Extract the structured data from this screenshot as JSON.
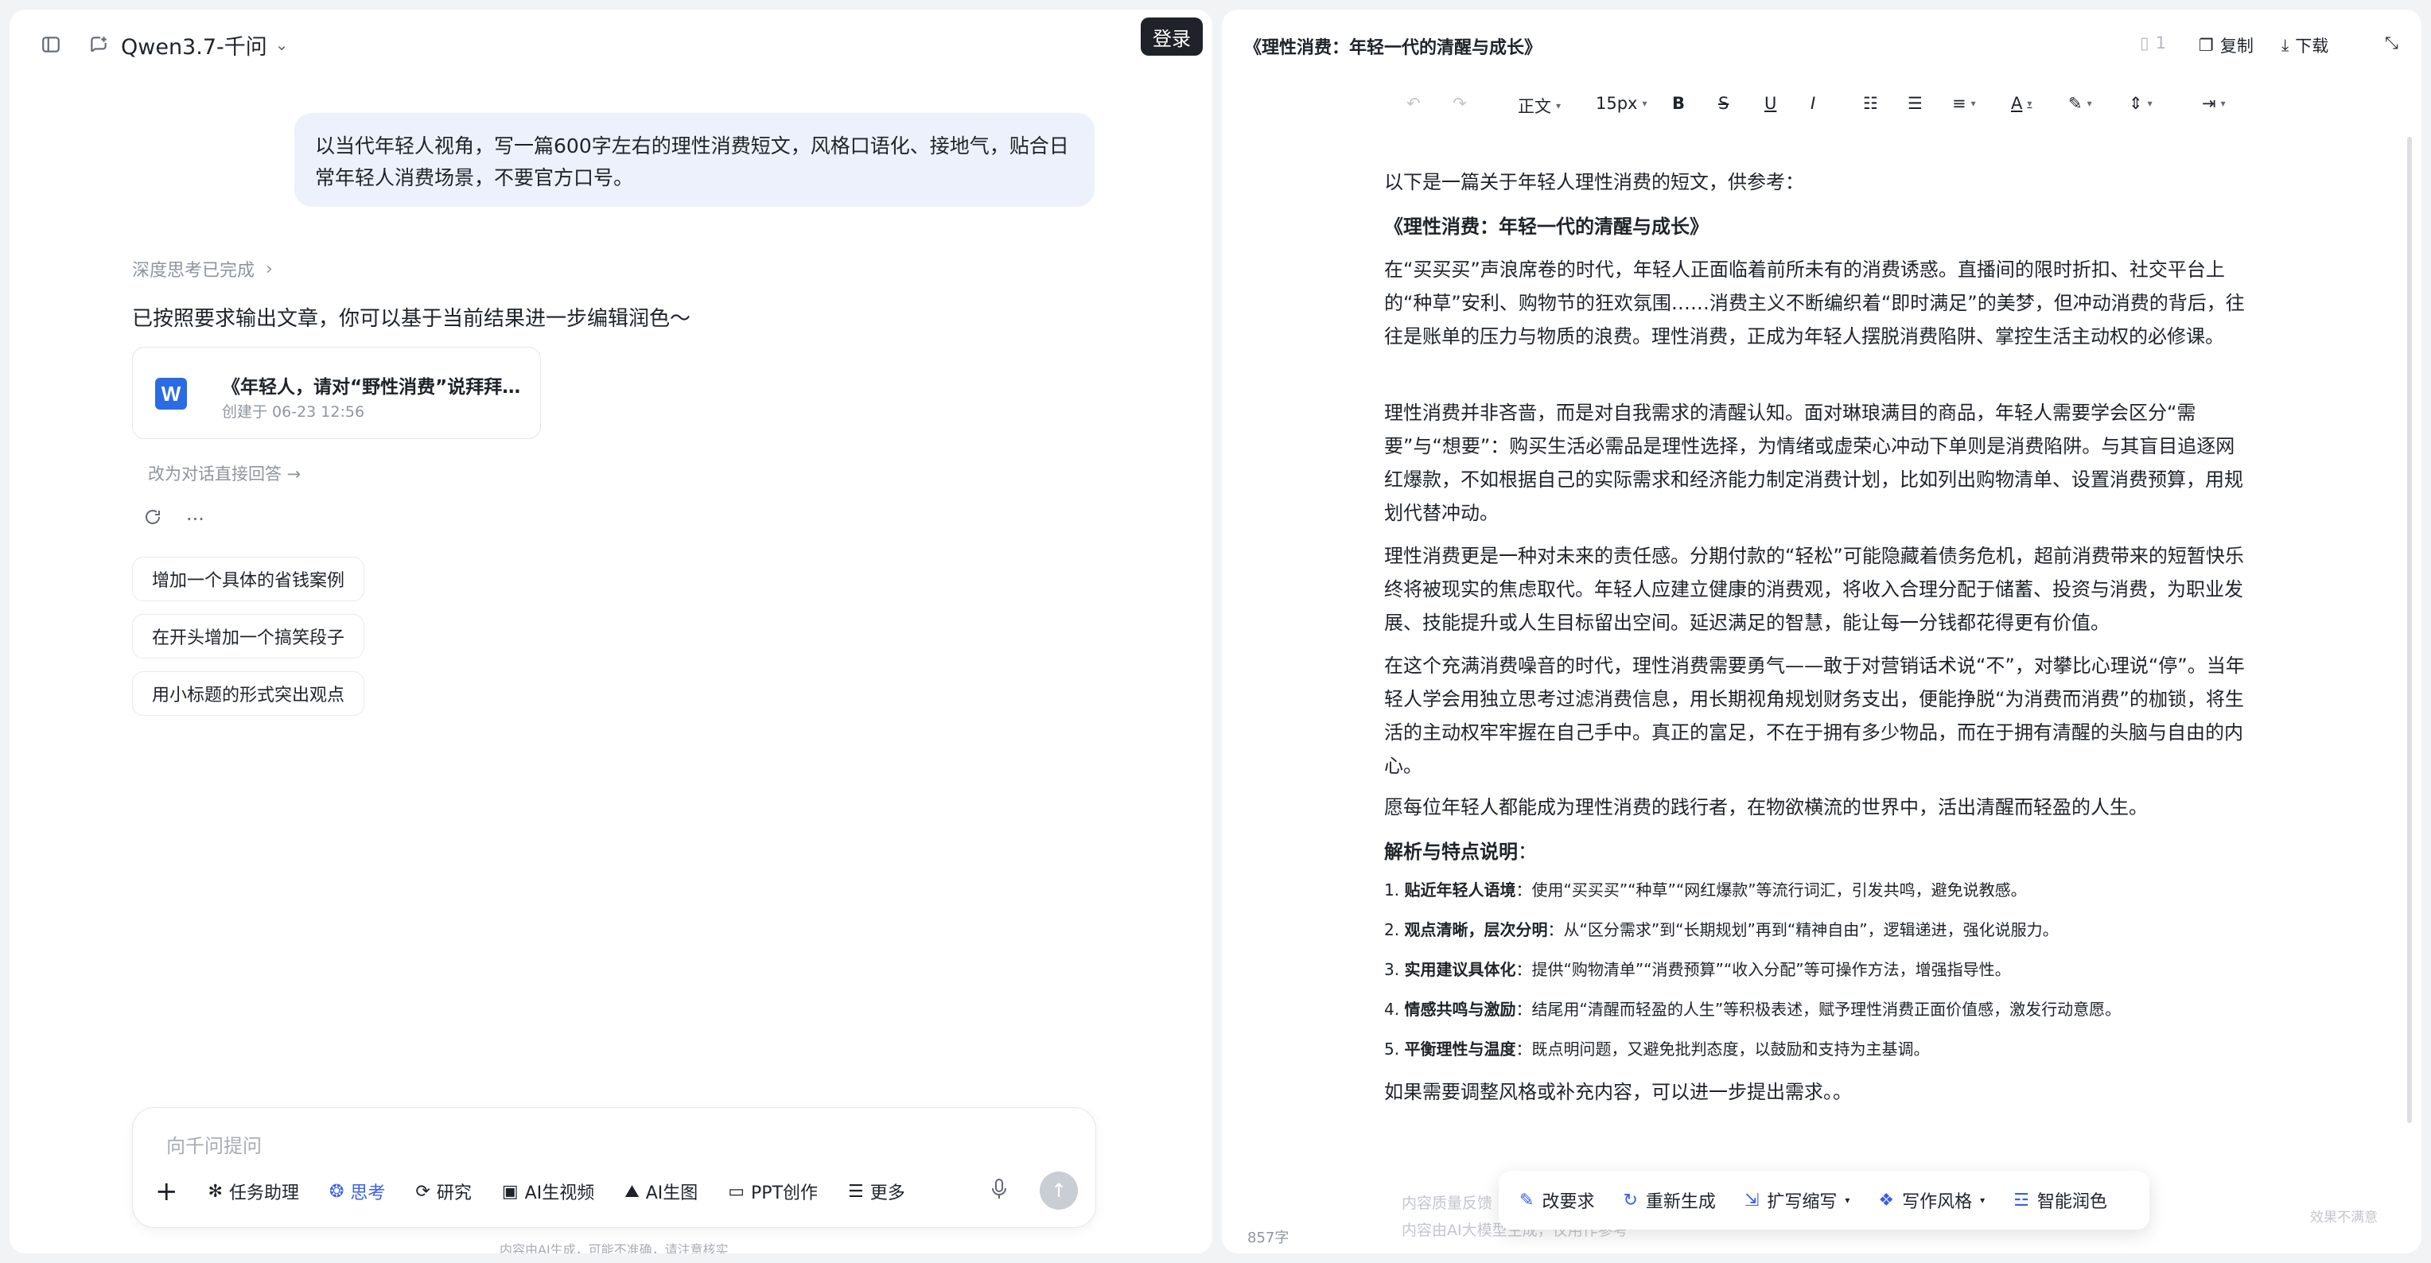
{
  "left": {
    "model_name": "Qwen3.7-千问",
    "login_label": "登录",
    "user_message": "以当代年轻人视角，写一篇600字左右的理性消费短文，风格口语化、接地气，贴合日常年轻人消费场景，不要官方口号。",
    "think_done": "深度思考已完成",
    "answer_text": "已按照要求输出文章，你可以基于当前结果进一步编辑润色～",
    "doc_card": {
      "icon_letter": "W",
      "title": "《年轻人，请对“野性消费”说拜拜…",
      "created": "创建于 06-23 12:56"
    },
    "switch_link": "改为对话直接回答 →",
    "suggestions": [
      "增加一个具体的省钱案例",
      "在开头增加一个搞笑段子",
      "用小标题的形式突出观点"
    ],
    "input_placeholder": "向千问提问",
    "tools": [
      "任务助理",
      "思考",
      "研究",
      "AI生视频",
      "AI生图",
      "PPT创作",
      "更多"
    ],
    "disclaimer": "内容由AI生成，可能不准确，请注意核实"
  },
  "right": {
    "title": "《理性消费：年轻一代的清醒与成长》",
    "page_count": "1",
    "copy_label": "复制",
    "download_label": "下载",
    "toolbar": {
      "style": "正文",
      "font_size": "15px",
      "bold": "B",
      "strike": "S",
      "underline": "U",
      "italic": "I",
      "font_color": "A"
    },
    "paragraphs": {
      "intro": "以下是一篇关于年轻人理性消费的短文，供参考：",
      "heading": "《理性消费：年轻一代的清醒与成长》",
      "p1": "在“买买买”声浪席卷的时代，年轻人正面临着前所未有的消费诱惑。直播间的限时折扣、社交平台上的“种草”安利、购物节的狂欢氛围……消费主义不断编织着“即时满足”的美梦，但冲动消费的背后，往往是账单的压力与物质的浪费。理性消费，正成为年轻人摆脱消费陷阱、掌控生活主动权的必修课。",
      "p2": "理性消费并非吝啬，而是对自我需求的清醒认知。面对琳琅满目的商品，年轻人需要学会区分“需要”与“想要”：购买生活必需品是理性选择，为情绪或虚荣心冲动下单则是消费陷阱。与其盲目追逐网红爆款，不如根据自己的实际需求和经济能力制定消费计划，比如列出购物清单、设置消费预算，用规划代替冲动。",
      "p3": "理性消费更是一种对未来的责任感。分期付款的“轻松”可能隐藏着债务危机，超前消费带来的短暂快乐终将被现实的焦虑取代。年轻人应建立健康的消费观，将收入合理分配于储蓄、投资与消费，为职业发展、技能提升或人生目标留出空间。延迟满足的智慧，能让每一分钱都花得更有价值。",
      "p4": "在这个充满消费噪音的时代，理性消费需要勇气——敢于对营销话术说“不”，对攀比心理说“停”。当年轻人学会用独立思考过滤消费信息，用长期视角规划财务支出，便能挣脱“为消费而消费”的枷锁，将生活的主动权牢牢握在自己手中。真正的富足，不在于拥有多少物品，而在于拥有清醒的头脑与自由的内心。",
      "p5": "愿每位年轻人都能成为理性消费的践行者，在物欲横流的世界中，活出清醒而轻盈的人生。",
      "analysis_title": "解析与特点说明",
      "analysis_colon": "：",
      "items": [
        {
          "num": "1. ",
          "label": "贴近年轻人语境",
          "text": "：使用“买买买”“种草”“网红爆款”等流行词汇，引发共鸣，避免说教感。"
        },
        {
          "num": "2. ",
          "label": "观点清晰，层次分明",
          "text": "：从“区分需求”到“长期规划”再到“精神自由”，逻辑递进，强化说服力。"
        },
        {
          "num": "3. ",
          "label": "实用建议具体化",
          "text": "：提供“购物清单”“消费预算”“收入分配”等可操作方法，增强指导性。"
        },
        {
          "num": "4. ",
          "label": "情感共鸣与激励",
          "text": "：结尾用“清醒而轻盈的人生”等积极表述，赋予理性消费正面价值感，激发行动意愿。"
        },
        {
          "num": "5. ",
          "label": "平衡理性与温度",
          "text": "：既点明问题，又避免批判态度，以鼓励和支持为主基调。"
        }
      ],
      "closing": "如果需要调整风格或补充内容，可以进一步提出需求。。"
    },
    "feedback_left": "内容质量反馈",
    "feedback_left2": "内容由AI大模型生成，仅用作参考",
    "feedback_right": "效果不满意",
    "ai_toolbar": [
      "改要求",
      "重新生成",
      "扩写缩写",
      "写作风格",
      "智能润色"
    ],
    "word_count": "857字"
  },
  "colors": {
    "accent": "#3b5ee8",
    "bubble": "#edf1fb",
    "dark_button": "#1f2329"
  }
}
